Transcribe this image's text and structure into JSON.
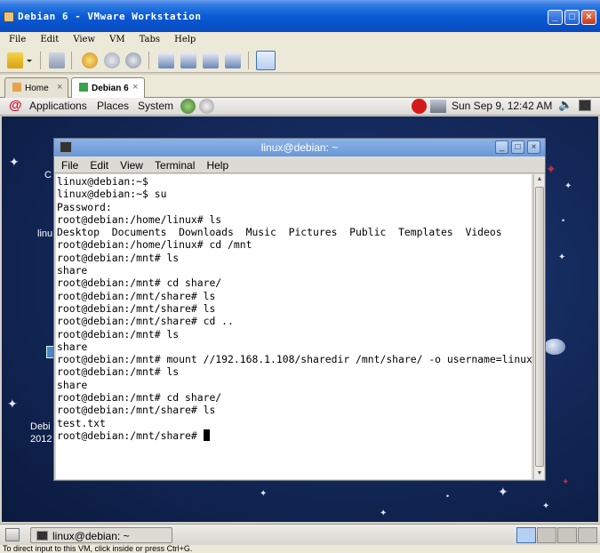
{
  "vmware": {
    "title": "Debian 6 - VMware Workstation",
    "menu": [
      "File",
      "Edit",
      "View",
      "VM",
      "Tabs",
      "Help"
    ],
    "tabs": [
      {
        "label": "Home"
      },
      {
        "label": "Debian 6"
      }
    ],
    "status_text": "To direct input to this VM, click inside or press Ctrl+G."
  },
  "gnome_panel": {
    "applications": "Applications",
    "places": "Places",
    "system": "System",
    "clock": "Sun Sep  9, 12:42 AM"
  },
  "desktop": {
    "icon_fragments": [
      "C",
      "linu",
      "Debi",
      "2012"
    ]
  },
  "terminal": {
    "title": "linux@debian: ~",
    "menu": [
      "File",
      "Edit",
      "View",
      "Terminal",
      "Help"
    ],
    "lines": [
      "linux@debian:~$",
      "linux@debian:~$ su",
      "Password:",
      "root@debian:/home/linux# ls",
      "Desktop  Documents  Downloads  Music  Pictures  Public  Templates  Videos",
      "root@debian:/home/linux# cd /mnt",
      "root@debian:/mnt# ls",
      "share",
      "root@debian:/mnt# cd share/",
      "root@debian:/mnt/share# ls",
      "root@debian:/mnt/share# ls",
      "root@debian:/mnt/share# cd ..",
      "root@debian:/mnt# ls",
      "share",
      "root@debian:/mnt# mount //192.168.1.108/sharedir /mnt/share/ -o username=linux",
      "root@debian:/mnt# ls",
      "share",
      "root@debian:/mnt# cd share/",
      "root@debian:/mnt/share# ls",
      "test.txt"
    ],
    "prompt": "root@debian:/mnt/share# "
  },
  "taskbar": {
    "window_button": "linux@debian: ~"
  }
}
